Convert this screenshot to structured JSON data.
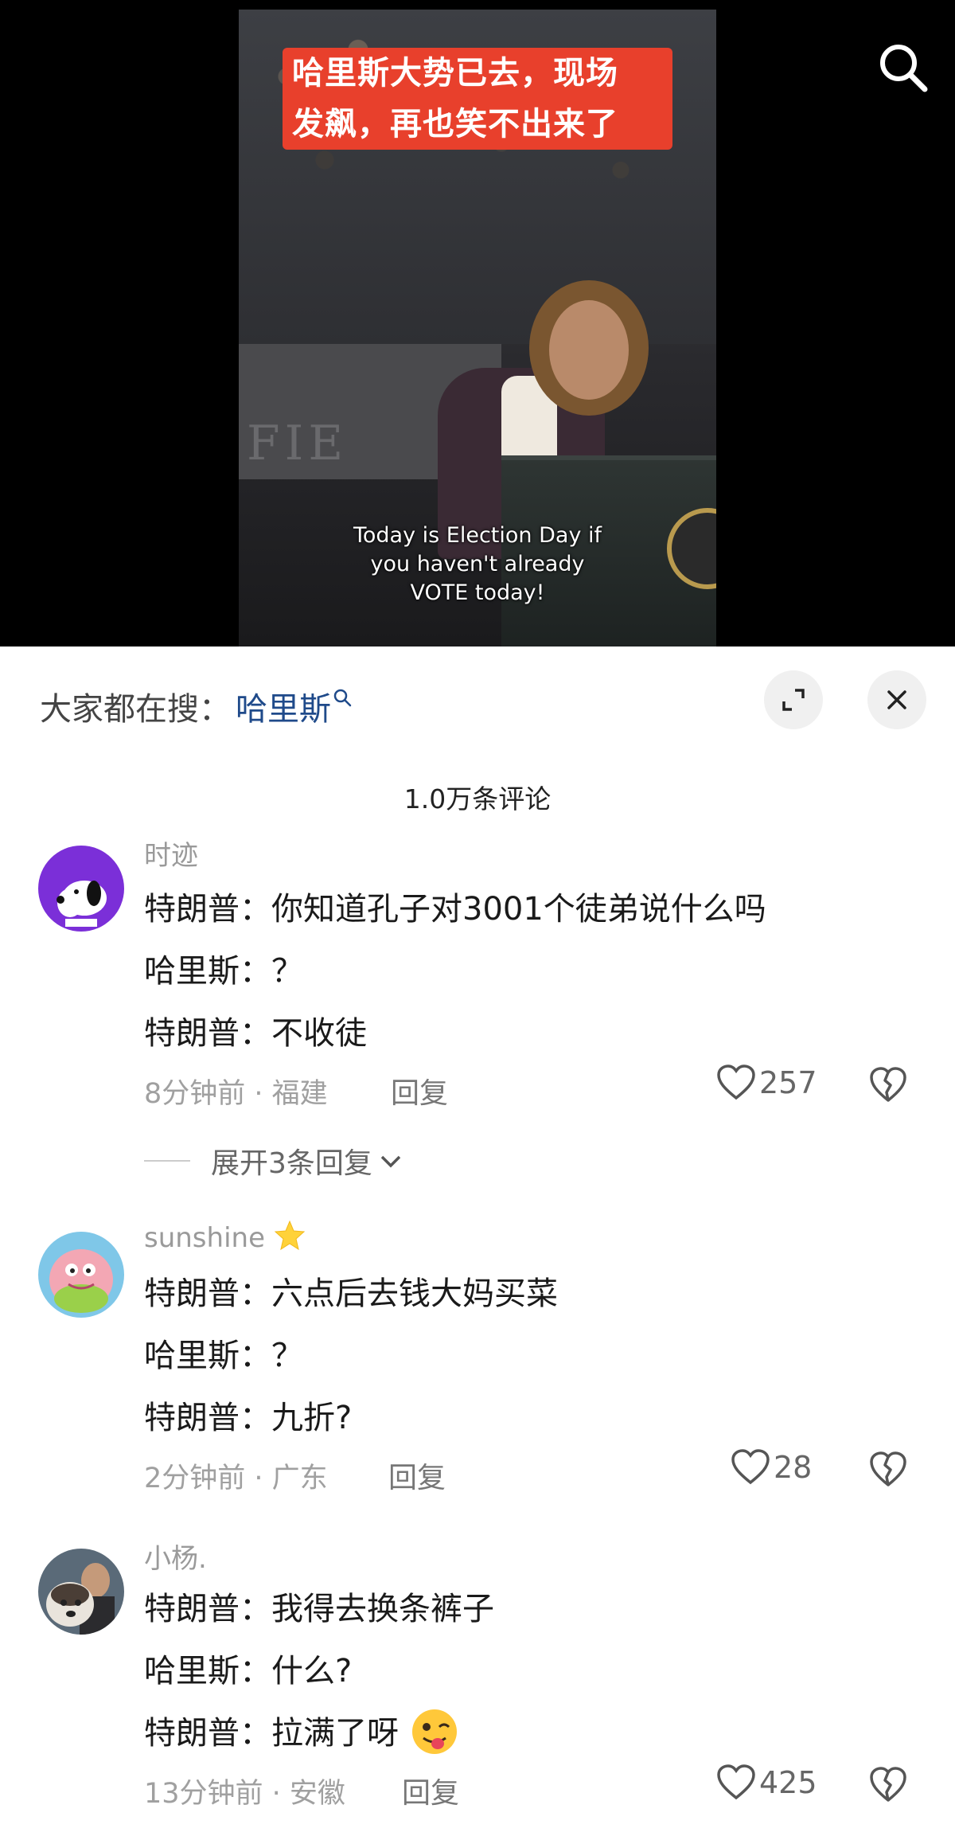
{
  "video": {
    "title_lines": [
      "哈里斯大势已去，现场",
      "发飙，再也笑不出来了"
    ],
    "subtitle_lines": [
      "Today is Election Day if",
      "you haven't already",
      "VOTE today!"
    ]
  },
  "sheet": {
    "search_prefix": "大家都在搜：",
    "search_term": "哈里斯",
    "comment_count": "1.0万条评论"
  },
  "comments": [
    {
      "username": "时迹",
      "lines": [
        "特朗普：你知道孔子对3001个徒弟说什么吗",
        "哈里斯：？",
        "特朗普：不收徒"
      ],
      "time_location": "8分钟前 · 福建",
      "reply_label": "回复",
      "likes": "257",
      "expand_label": "展开3条回复"
    },
    {
      "username": "sunshine",
      "lines": [
        "特朗普：六点后去钱大妈买菜",
        "哈里斯：？",
        "特朗普：九折?"
      ],
      "time_location": "2分钟前 · 广东",
      "reply_label": "回复",
      "likes": "28"
    },
    {
      "username": "小杨.",
      "lines": [
        "特朗普：我得去换条裤子",
        "哈里斯：什么?",
        "特朗普：拉满了呀"
      ],
      "time_location": "13分钟前 · 安徽",
      "reply_label": "回复",
      "likes": "425"
    }
  ],
  "colors": {
    "title_bg": "#e8402c",
    "search_term": "#1f4a8a",
    "meta_text": "#a0a0a0"
  },
  "icons": [
    "search-icon",
    "expand-icon",
    "close-icon",
    "heart-icon",
    "broken-heart-icon",
    "chevron-down-icon",
    "star-icon",
    "tongue-wink-emoji"
  ]
}
